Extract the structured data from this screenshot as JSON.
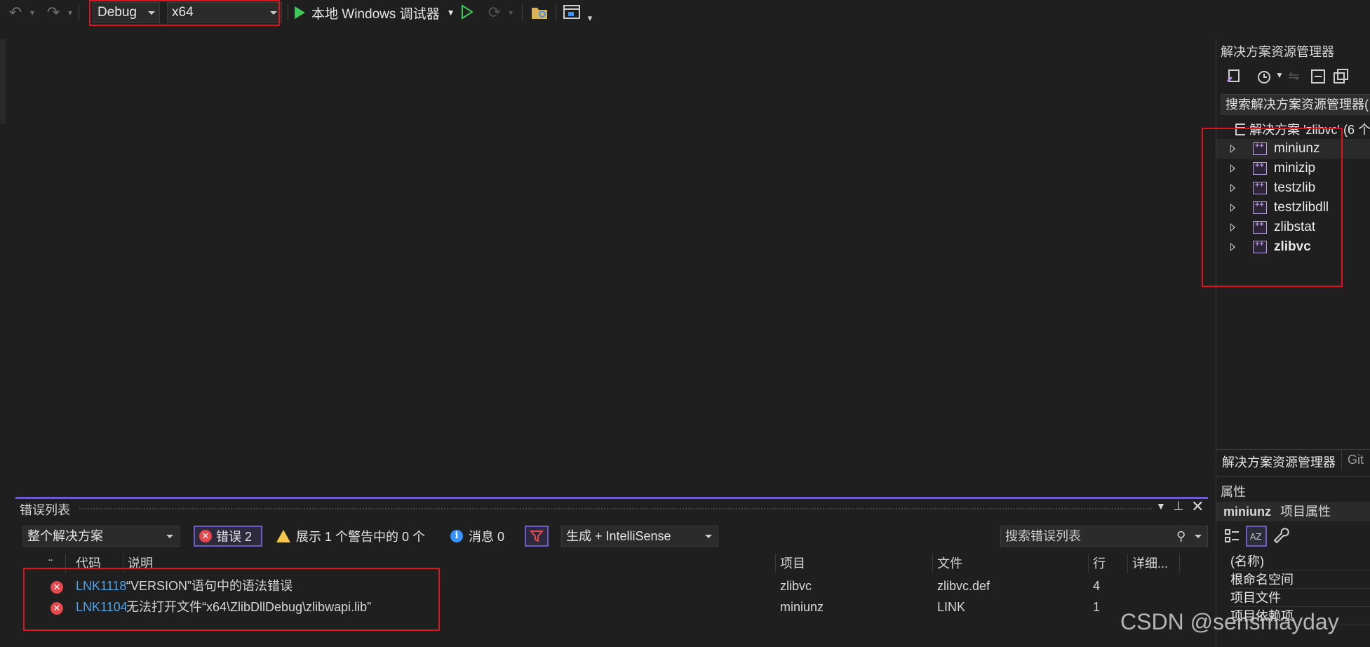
{
  "toolbar": {
    "config": "Debug",
    "platform": "x64",
    "run_label": "本地 Windows 调试器",
    "accent": "#3ec85b"
  },
  "solution_explorer": {
    "title": "解决方案资源管理器",
    "search_placeholder": "搜索解决方案资源管理器(",
    "solution_label": "解决方案 'zlibvc' (6 个",
    "projects": [
      {
        "name": "miniunz",
        "bold": false
      },
      {
        "name": "minizip",
        "bold": false
      },
      {
        "name": "testzlib",
        "bold": false
      },
      {
        "name": "testzlibdll",
        "bold": false
      },
      {
        "name": "zlibstat",
        "bold": false
      },
      {
        "name": "zlibvc",
        "bold": true
      }
    ],
    "tabs": [
      "解决方案资源管理器",
      "Git"
    ]
  },
  "properties": {
    "title": "属性",
    "header_name": "miniunz",
    "header_suffix": "项目属性",
    "rows": [
      "(名称)",
      "根命名空间",
      "项目文件",
      "项目依赖项"
    ]
  },
  "error_list": {
    "title": "错误列表",
    "scope": "整个解决方案",
    "errors_chip": "错误 2",
    "warnings_chip": "展示 1 个警告中的 0 个",
    "messages_chip": "消息 0",
    "build_filter": "生成 + IntelliSense",
    "search_placeholder": "搜索错误列表",
    "columns": [
      "代码",
      "说明",
      "项目",
      "文件",
      "行",
      "详细..."
    ],
    "rows": [
      {
        "code": "LNK1118",
        "desc": "“VERSION”语句中的语法错误",
        "project": "zlibvc",
        "file": "zlibvc.def",
        "line": "4"
      },
      {
        "code": "LNK1104",
        "desc": "无法打开文件“x64\\ZlibDllDebug\\zlibwapi.lib”",
        "project": "miniunz",
        "file": "LINK",
        "line": "1"
      }
    ]
  },
  "watermark": "CSDN @sensmayday",
  "colors": {
    "highlight_box": "#e0121b",
    "panel_accent": "#6b5fc7",
    "error_red": "#e5484d"
  }
}
